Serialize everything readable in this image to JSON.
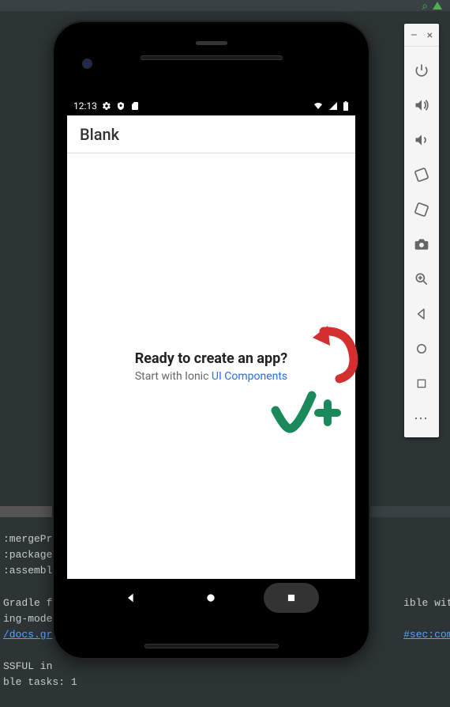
{
  "statusbar": {
    "time": "12:13"
  },
  "app": {
    "title": "Blank",
    "headline": "Ready to create an app?",
    "sub_prefix": "Start with Ionic ",
    "sub_link": "UI Components"
  },
  "terminal": {
    "l1": ":mergePr",
    "l2": ":package",
    "l3": ":assembl",
    "l4a": "Gradle f",
    "l4b": "ible with Gr",
    "l5": "ing-mode",
    "l6a": "/docs.gr",
    "l6b": "#sec:command_",
    "l7": "SSFUL in",
    "l8": "ble tasks: 1"
  },
  "emu": {
    "minimize": "–",
    "close": "×",
    "more": "⋯"
  }
}
